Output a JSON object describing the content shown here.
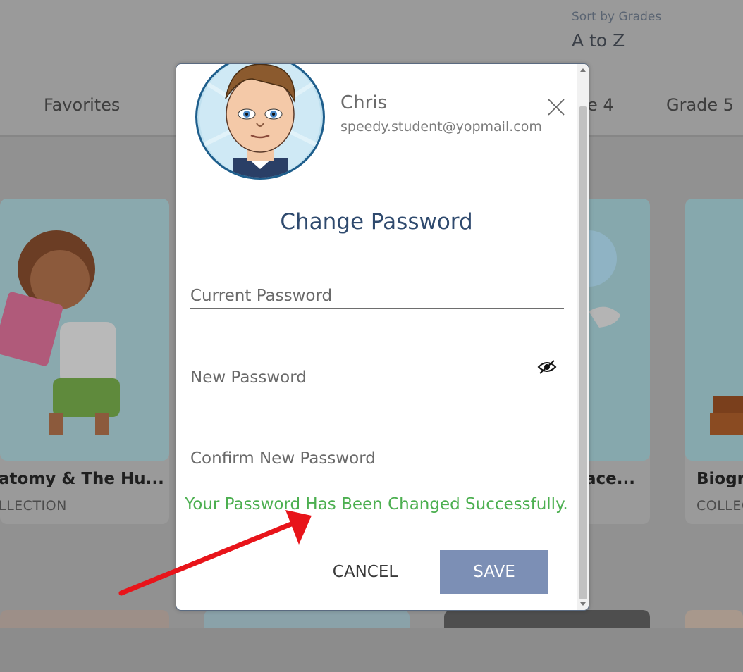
{
  "background": {
    "sort": {
      "label": "Sort by Grades",
      "value": "A to Z"
    },
    "nav_tabs": [
      "Favorites",
      "e 4",
      "Grade 5"
    ],
    "cards": [
      {
        "title": "atomy & The Hu...",
        "subtitle": "LLECTION"
      },
      {
        "title": "ace...",
        "subtitle": ""
      },
      {
        "title": "Biogra",
        "subtitle": "COLLEC"
      }
    ]
  },
  "modal": {
    "user": {
      "name": "Chris",
      "email": "speedy.student@yopmail.com"
    },
    "title": "Change Password",
    "fields": {
      "current_placeholder": "Current Password",
      "new_placeholder": "New Password",
      "confirm_placeholder": "Confirm New Password"
    },
    "success_message": "Your Password Has Been Changed Successfully.",
    "buttons": {
      "cancel": "CANCEL",
      "save": "SAVE"
    }
  },
  "colors": {
    "success": "#4caf50",
    "save_button": "#7c8fb5",
    "title": "#2f4a6e",
    "annotation_arrow": "#e8141a"
  },
  "icons": {
    "close": "close-icon",
    "visibility": "eye-slash-icon"
  }
}
